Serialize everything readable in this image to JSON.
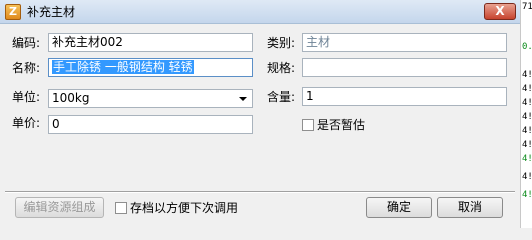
{
  "window": {
    "title": "补充主材",
    "icon_glyph": "Z",
    "close_glyph": "X"
  },
  "form": {
    "code": {
      "label": "编码:",
      "value": "补充主材002"
    },
    "category": {
      "label": "类别:",
      "value": "主材"
    },
    "name": {
      "label": "名称:",
      "value": "手工除锈 一般钢结构 轻锈"
    },
    "spec": {
      "label": "规格:",
      "value": ""
    },
    "unit": {
      "label": "单位:",
      "value": "100kg"
    },
    "content": {
      "label": "含量:",
      "value": "1"
    },
    "price": {
      "label": "单价:",
      "value": "0"
    },
    "provisional": {
      "label": "是否暂估",
      "checked": false
    }
  },
  "footer": {
    "edit_resources_button": "编辑资源组成",
    "save_archive_checkbox": "存档以方便下次调用",
    "ok_button": "确定",
    "cancel_button": "取消"
  },
  "background_strip": [
    {
      "text": "71",
      "color": "#000000"
    },
    {
      "text": "0.",
      "color": "#0a8a1a"
    },
    {
      "text": "4!",
      "color": "#000000"
    },
    {
      "text": "4!",
      "color": "#000000"
    },
    {
      "text": "4!",
      "color": "#000000"
    },
    {
      "text": "4!",
      "color": "#000000"
    },
    {
      "text": "4!",
      "color": "#000000"
    },
    {
      "text": "4!",
      "color": "#000000"
    },
    {
      "text": "4!",
      "color": "#0a8a1a"
    },
    {
      "text": "4!",
      "color": "#000000"
    },
    {
      "text": "4!",
      "color": "#0a8a1a"
    }
  ],
  "colors": {
    "selection": "#3399ff",
    "disabled_text": "#9a9a9a"
  }
}
